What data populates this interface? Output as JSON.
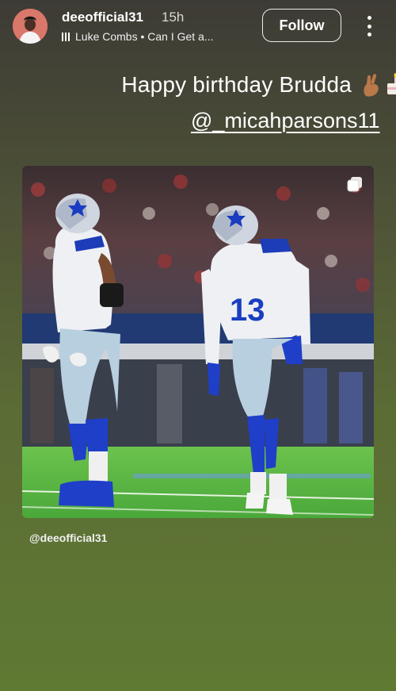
{
  "story": {
    "username": "deeofficial31",
    "time": "15h",
    "music": "Luke Combs • Can I Get a...",
    "follow_label": "Follow",
    "caption": "Happy birthday Brudda",
    "mention": "@_micahparsons11",
    "credit": "@deeofficial31"
  },
  "icons": {
    "avatar": "user-avatar",
    "music": "audio-bars-icon",
    "more": "more-vertical-icon",
    "carousel": "multiple-photos-icon",
    "emoji_1": "crossed-fingers-emoji",
    "emoji_2": "cake-emoji"
  },
  "photo": {
    "jersey_number": "13",
    "description_colors": {
      "jersey": "#eef0f4",
      "number": "#1a3ec0",
      "pants": "#b8cfe0",
      "socks": "#1f3fc9",
      "field": "#58b93f"
    }
  },
  "colors": {
    "follow_border": "#ededed",
    "text": "#ffffff"
  }
}
